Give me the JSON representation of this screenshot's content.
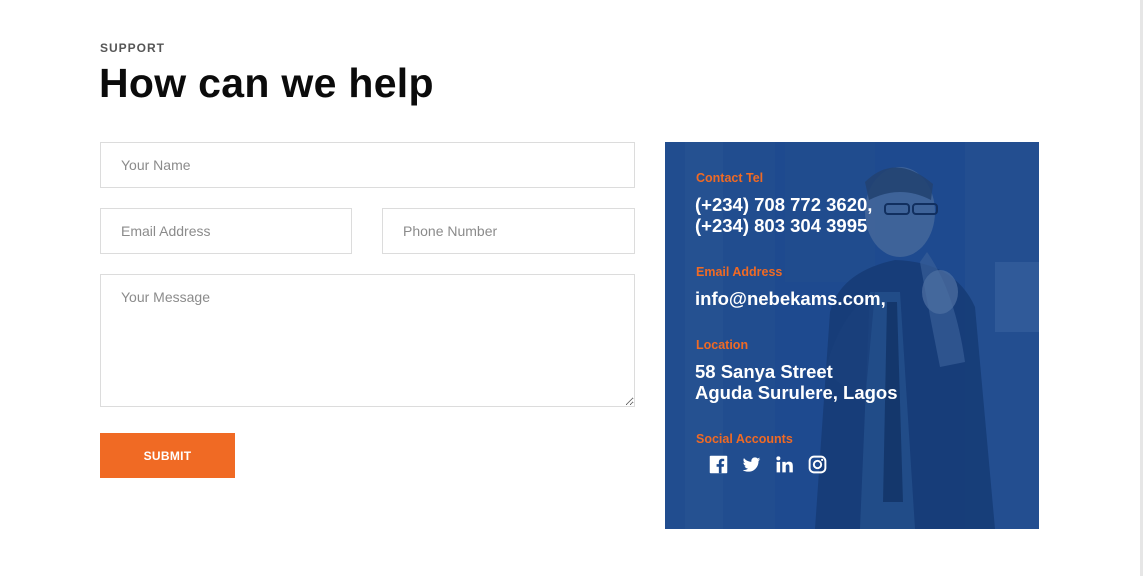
{
  "section": {
    "eyebrow": "SUPPORT",
    "title": "How can we help"
  },
  "form": {
    "name_placeholder": "Your Name",
    "email_placeholder": "Email Address",
    "phone_placeholder": "Phone Number",
    "message_placeholder": "Your Message",
    "submit_label": "SUBMIT"
  },
  "contact": {
    "tel_label": "Contact Tel",
    "tel_line1": "(+234) 708 772 3620,",
    "tel_line2": "(+234) 803 304 3995",
    "email_label": "Email Address",
    "email_value": "info@nebekams.com,",
    "location_label": "Location",
    "location_line1": "58 Sanya Street",
    "location_line2": "Aguda Surulere, Lagos",
    "social_label": "Social Accounts",
    "social_icons": [
      "facebook-icon",
      "twitter-icon",
      "linkedin-icon",
      "instagram-icon"
    ]
  },
  "colors": {
    "accent": "#f06a24",
    "card_bg": "#1d4a8e",
    "title": "#0b0b0b"
  }
}
